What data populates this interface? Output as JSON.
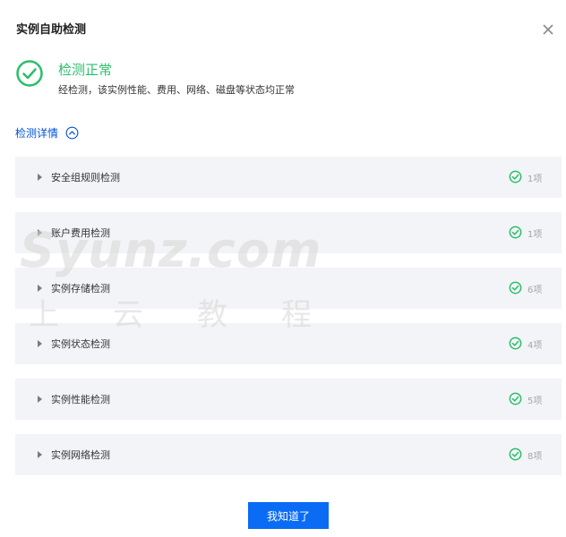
{
  "dialog": {
    "title": "实例自助检测",
    "close_icon": "close-icon"
  },
  "status": {
    "icon": "check-circle-icon",
    "title": "检测正常",
    "description": "经检测，该实例性能、费用、网络、磁盘等状态均正常",
    "color": "#29bf6a"
  },
  "details": {
    "label": "检测详情",
    "icon": "chevron-up-circle-icon",
    "color": "#0052d9"
  },
  "checks": [
    {
      "name": "安全组规则检测",
      "count": "1项"
    },
    {
      "name": "账户费用检测",
      "count": "1项"
    },
    {
      "name": "实例存储检测",
      "count": "6项"
    },
    {
      "name": "实例状态检测",
      "count": "4项"
    },
    {
      "name": "实例性能检测",
      "count": "5项"
    },
    {
      "name": "实例网络检测",
      "count": "8项"
    }
  ],
  "watermark": {
    "big": "Syunz.com",
    "small": "上云教程"
  },
  "footer": {
    "confirm_label": "我知道了",
    "accent": "#0a6cf5"
  }
}
